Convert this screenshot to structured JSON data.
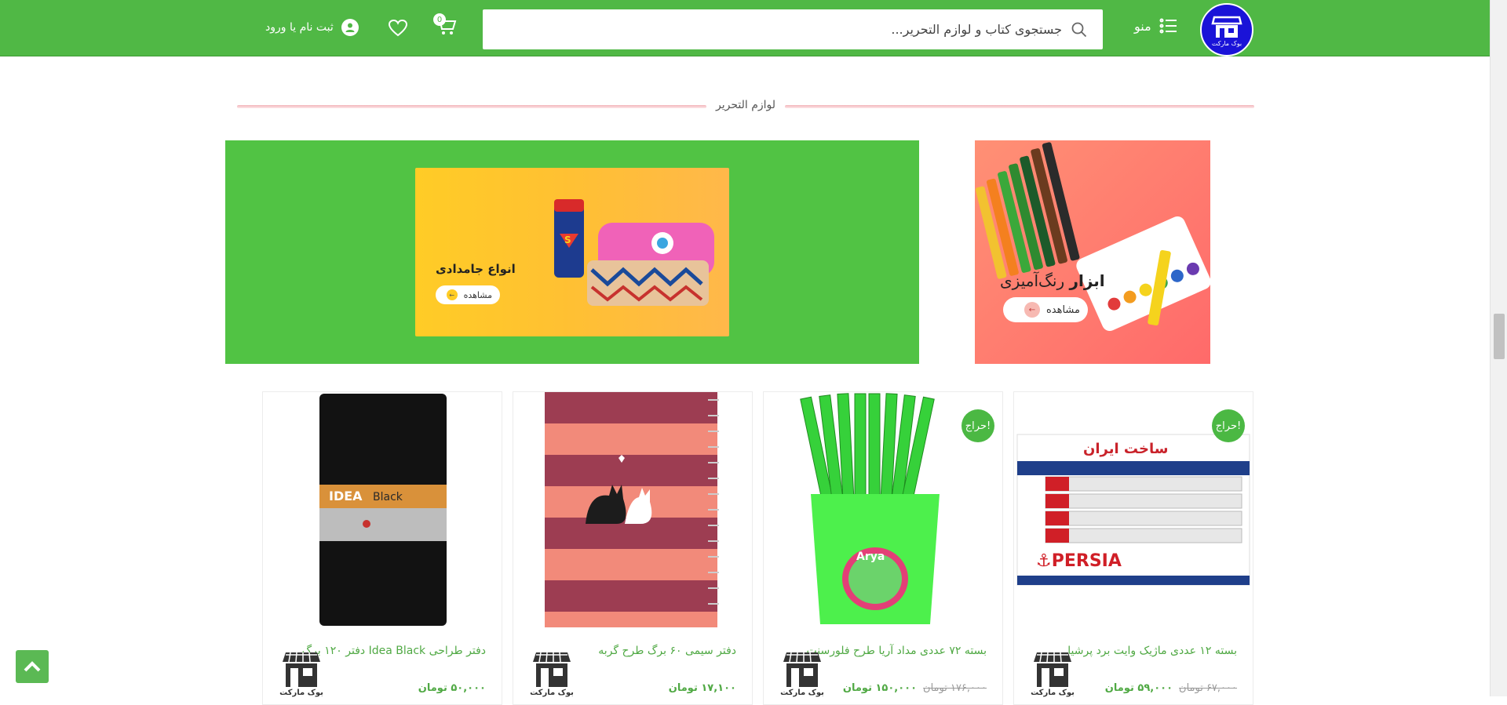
{
  "header": {
    "logo_text": "بوک مارکت",
    "menu_label": "منو",
    "search_placeholder": "جستجوی کتاب و لوازم التحریر...",
    "cart_count": "0",
    "login_label": "ثبت نام یا ورود"
  },
  "section": {
    "title": "لوازم التحریر"
  },
  "banners": {
    "pencil_cases": {
      "title": "انواع جامدادی",
      "button": "مشاهده"
    },
    "paint_tools": {
      "title_bold": "ابزار",
      "title_rest": "رنگ‌آمیزی",
      "button": "مشاهده"
    }
  },
  "products": [
    {
      "name": "دفتر طراحی Idea Black دفتر ۱۲۰ برگ",
      "old_price": "",
      "price": "۵۰,۰۰۰ تومان",
      "sale": "",
      "watermark": "بوک مارکت"
    },
    {
      "name": "دفتر سیمی ۶۰ برگ طرح گربه",
      "old_price": "",
      "price": "۱۷,۱۰۰ تومان",
      "sale": "",
      "watermark": "بوک مارکت"
    },
    {
      "name": "بسته ۷۲ عددی مداد آریا طرح فلورسنت",
      "old_price": "۱۷۶,۰۰۰ تومان",
      "price": "۱۵۰,۰۰۰ تومان",
      "sale": "حراج!",
      "watermark": "بوک مارکت"
    },
    {
      "name": "بسته ۱۲ عددی ماژیک وایت برد پرشیا",
      "old_price": "۶۷,۰۰۰ تومان",
      "price": "۵۹,۰۰۰ تومان",
      "sale": "حراج!",
      "watermark": "بوک مارکت"
    }
  ],
  "colors": {
    "brand_green": "#50b845",
    "sale_badge": "#4bb843",
    "logo_blue": "#1a13d8"
  },
  "icons": [
    "menu-icon",
    "search-icon",
    "cart-icon",
    "heart-icon",
    "user-icon",
    "arrow-up-icon",
    "arrow-left-icon"
  ]
}
